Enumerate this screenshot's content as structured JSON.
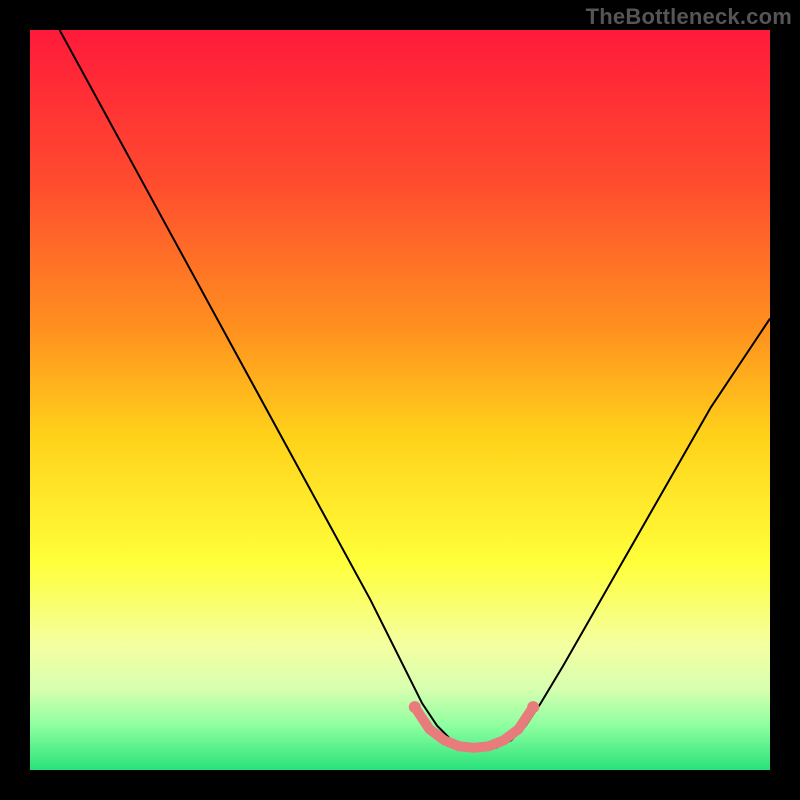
{
  "watermark": "TheBottleneck.com",
  "chart_data": {
    "type": "line",
    "title": "",
    "xlabel": "",
    "ylabel": "",
    "xlim": [
      0,
      100
    ],
    "ylim": [
      0,
      100
    ],
    "background_gradient": {
      "stops": [
        {
          "offset": 0.0,
          "color": "#ff1a3a"
        },
        {
          "offset": 0.2,
          "color": "#ff4a2f"
        },
        {
          "offset": 0.4,
          "color": "#ff8f1f"
        },
        {
          "offset": 0.55,
          "color": "#ffd21a"
        },
        {
          "offset": 0.72,
          "color": "#ffff3a"
        },
        {
          "offset": 0.83,
          "color": "#f4ffa0"
        },
        {
          "offset": 0.89,
          "color": "#d8ffb0"
        },
        {
          "offset": 0.94,
          "color": "#8effa0"
        },
        {
          "offset": 1.0,
          "color": "#28e27a"
        }
      ]
    },
    "series": [
      {
        "name": "bottleneck-curve",
        "color": "#000000",
        "width": 2,
        "x": [
          4,
          10,
          16,
          22,
          28,
          34,
          40,
          46,
          51,
          53,
          55,
          57,
          59,
          61,
          63,
          65,
          67,
          69,
          72,
          76,
          80,
          84,
          88,
          92,
          96,
          100
        ],
        "y": [
          100,
          89,
          78,
          67,
          56,
          45,
          34,
          23,
          13,
          9,
          6,
          4,
          3,
          3,
          3,
          4,
          6,
          9,
          14,
          21,
          28,
          35,
          42,
          49,
          55,
          61
        ]
      },
      {
        "name": "optimal-band",
        "color": "#e87b7b",
        "width": 10,
        "linecap": "round",
        "x": [
          52,
          54,
          56,
          58,
          60,
          62,
          64,
          66,
          68
        ],
        "y": [
          8.5,
          5.5,
          4,
          3.2,
          3,
          3.2,
          4,
          5.5,
          8.5
        ]
      }
    ],
    "markers": [
      {
        "name": "optimal-dot-left",
        "x": 52,
        "y": 8.5,
        "r": 6,
        "color": "#e87b7b"
      },
      {
        "name": "optimal-dot-right",
        "x": 68,
        "y": 8.5,
        "r": 6,
        "color": "#e87b7b"
      }
    ]
  }
}
